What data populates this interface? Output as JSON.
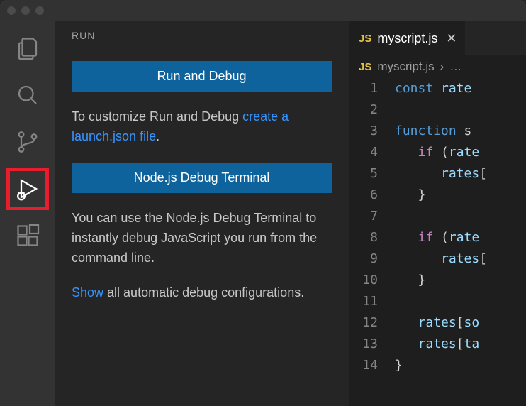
{
  "sidebar": {
    "title": "RUN",
    "run_debug_button": "Run and Debug",
    "customize_text": "To customize Run and Debug ",
    "create_launch_link": "create a launch.json file",
    "node_terminal_button": "Node.js Debug Terminal",
    "node_info_text": "You can use the Node.js Debug Terminal to instantly debug JavaScript you run from the command line.",
    "show_link": "Show",
    "show_text": " all automatic debug configurations."
  },
  "activitybar": {
    "items": [
      "explorer",
      "search",
      "source-control",
      "run-debug",
      "extensions"
    ],
    "active": "run-debug"
  },
  "editor": {
    "tab": {
      "badge": "JS",
      "filename": "myscript.js"
    },
    "breadcrumb": {
      "badge": "JS",
      "filename": "myscript.js",
      "sep": "›",
      "tail": "…"
    },
    "lines": [
      {
        "n": 1,
        "indent": 0,
        "tokens": [
          [
            "kw",
            "const"
          ],
          [
            "punc",
            " "
          ],
          [
            "var",
            "rate"
          ]
        ]
      },
      {
        "n": 2,
        "indent": 0,
        "tokens": []
      },
      {
        "n": 3,
        "indent": 0,
        "tokens": [
          [
            "kw",
            "function"
          ],
          [
            "punc",
            " s"
          ]
        ]
      },
      {
        "n": 4,
        "indent": 1,
        "tokens": [
          [
            "ctl",
            "if"
          ],
          [
            "punc",
            " ("
          ],
          [
            "var",
            "rate"
          ]
        ]
      },
      {
        "n": 5,
        "indent": 2,
        "tokens": [
          [
            "var",
            "rates"
          ],
          [
            "punc",
            "["
          ]
        ]
      },
      {
        "n": 6,
        "indent": 1,
        "tokens": [
          [
            "punc",
            "}"
          ]
        ]
      },
      {
        "n": 7,
        "indent": 0,
        "tokens": []
      },
      {
        "n": 8,
        "indent": 1,
        "tokens": [
          [
            "ctl",
            "if"
          ],
          [
            "punc",
            " ("
          ],
          [
            "var",
            "rate"
          ]
        ]
      },
      {
        "n": 9,
        "indent": 2,
        "tokens": [
          [
            "var",
            "rates"
          ],
          [
            "punc",
            "["
          ]
        ]
      },
      {
        "n": 10,
        "indent": 1,
        "tokens": [
          [
            "punc",
            "}"
          ]
        ]
      },
      {
        "n": 11,
        "indent": 0,
        "tokens": []
      },
      {
        "n": 12,
        "indent": 1,
        "tokens": [
          [
            "var",
            "rates"
          ],
          [
            "punc",
            "["
          ],
          [
            "var",
            "so"
          ]
        ]
      },
      {
        "n": 13,
        "indent": 1,
        "tokens": [
          [
            "var",
            "rates"
          ],
          [
            "punc",
            "["
          ],
          [
            "var",
            "ta"
          ]
        ]
      },
      {
        "n": 14,
        "indent": 0,
        "tokens": [
          [
            "punc",
            "}"
          ]
        ]
      }
    ]
  }
}
